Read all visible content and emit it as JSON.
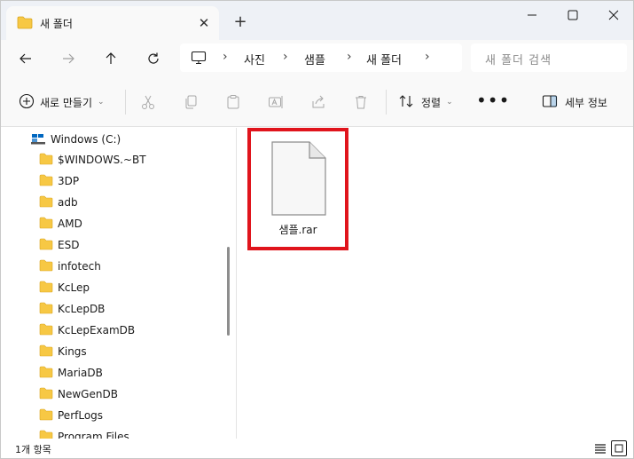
{
  "tab": {
    "title": "새 폴더",
    "close": "✕",
    "new": "+"
  },
  "address": {
    "segments": [
      "사진",
      "샘플",
      "새 폴더"
    ],
    "chevron": "›"
  },
  "search": {
    "placeholder": "새 폴더 검색"
  },
  "commands": {
    "new_label": "새로 만들기",
    "sort_label": "정렬",
    "more_label": "•••",
    "details_label": "세부 정보",
    "caret": "⌄"
  },
  "sidebar": {
    "drive_label": "Windows (C:)",
    "folders": [
      "$WINDOWS.~BT",
      "3DP",
      "adb",
      "AMD",
      "ESD",
      "infotech",
      "KcLep",
      "KcLepDB",
      "KcLepExamDB",
      "Kings",
      "MariaDB",
      "NewGenDB",
      "PerfLogs",
      "Program Files"
    ]
  },
  "files": [
    {
      "name": "샘플.rar"
    }
  ],
  "status": {
    "item_count": "1개 항목"
  },
  "colors": {
    "folder": "#f7c844",
    "highlight": "#e0141c",
    "accent": "#0067c0"
  },
  "icons": [
    "folder-icon",
    "close-icon",
    "plus-icon",
    "minimize-icon",
    "maximize-icon",
    "window-close-icon",
    "back-arrow-icon",
    "forward-arrow-icon",
    "up-arrow-icon",
    "refresh-icon",
    "computer-icon",
    "new-icon",
    "cut-icon",
    "copy-icon",
    "paste-icon",
    "rename-icon",
    "share-icon",
    "delete-icon",
    "sort-icon",
    "details-pane-icon",
    "drive-icon",
    "file-icon",
    "details-view-icon",
    "tiles-view-icon"
  ]
}
